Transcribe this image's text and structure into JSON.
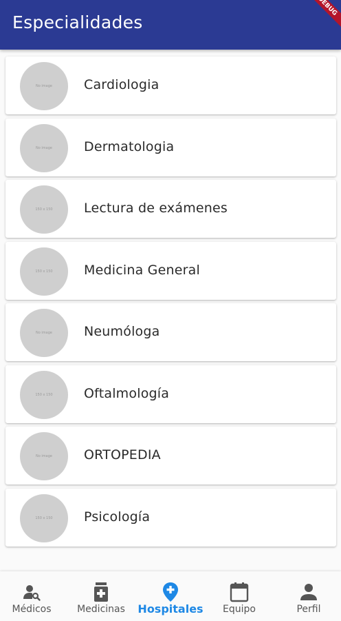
{
  "appbar": {
    "title": "Especialidades",
    "color": "#2b3a93",
    "debug_banner": "DEBUG"
  },
  "specialties": [
    {
      "name": "Cardiologia",
      "avatar_text": "No image"
    },
    {
      "name": "Dermatologia",
      "avatar_text": "No image"
    },
    {
      "name": "Lectura de exámenes",
      "avatar_text": "150 x 150"
    },
    {
      "name": "Medicina General",
      "avatar_text": "150 x 150"
    },
    {
      "name": "Neumóloga",
      "avatar_text": "No image"
    },
    {
      "name": "Oftalmología",
      "avatar_text": "150 x 150"
    },
    {
      "name": "ORTOPEDIA",
      "avatar_text": "No image"
    },
    {
      "name": "Psicología",
      "avatar_text": "150 x 150"
    }
  ],
  "bottom_nav": {
    "active_color": "#1e88e5",
    "items": [
      {
        "label": "Médicos",
        "icon": "doctor-search-icon",
        "active": false
      },
      {
        "label": "Medicinas",
        "icon": "medicine-icon",
        "active": false
      },
      {
        "label": "Hospitales",
        "icon": "hospital-pin-icon",
        "active": true
      },
      {
        "label": "Equipo",
        "icon": "calendar-icon",
        "active": false
      },
      {
        "label": "Perfil",
        "icon": "person-icon",
        "active": false
      }
    ]
  }
}
